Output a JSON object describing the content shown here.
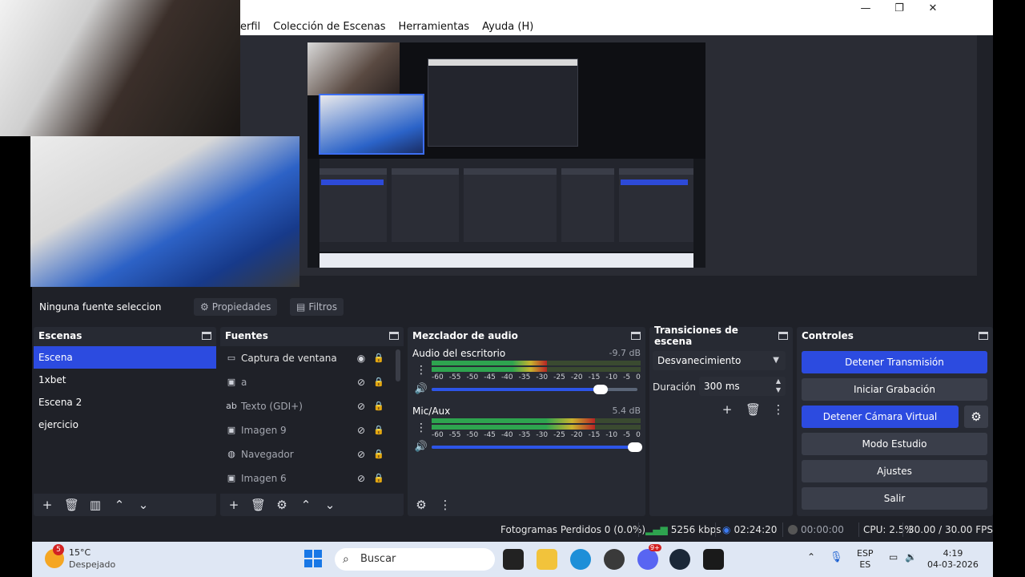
{
  "window": {
    "controls": [
      "—",
      "❐",
      "✕"
    ]
  },
  "menu": {
    "items": [
      "erfil",
      "Colección de Escenas",
      "Herramientas",
      "Ayuda (H)"
    ]
  },
  "source_bar": {
    "no_source": "Ninguna fuente seleccionad",
    "properties": "Propiedades",
    "filters": "Filtros"
  },
  "scenes": {
    "title": "Escenas",
    "items": [
      "Escena",
      "1xbet",
      "Escena 2",
      "ejercicio"
    ],
    "active_index": 0
  },
  "sources": {
    "title": "Fuentes",
    "items": [
      {
        "name": "Captura de ventana",
        "icon": "window-icon",
        "visible": true
      },
      {
        "name": "a",
        "icon": "image-icon",
        "visible": false
      },
      {
        "name": "Texto (GDI+)",
        "icon": "text-icon",
        "visible": false
      },
      {
        "name": "Imagen 9",
        "icon": "image-icon",
        "visible": false
      },
      {
        "name": "Navegador",
        "icon": "browser-icon",
        "visible": false
      },
      {
        "name": "Imagen 6",
        "icon": "image-icon",
        "visible": false
      }
    ]
  },
  "mixer": {
    "title": "Mezclador de audio",
    "channels": [
      {
        "name": "Audio del escritorio",
        "db": "-9.7 dB",
        "level": 0.55,
        "volume": 0.82
      },
      {
        "name": "Mic/Aux",
        "db": "5.4 dB",
        "level": 0.78,
        "volume": 0.99
      }
    ],
    "ticks": [
      "-60",
      "-55",
      "-50",
      "-45",
      "-40",
      "-35",
      "-30",
      "-25",
      "-20",
      "-15",
      "-10",
      "-5",
      "0"
    ]
  },
  "transitions": {
    "title": "Transiciones de escena",
    "selected": "Desvanecimiento",
    "duration_label": "Duración",
    "duration_value": "300 ms"
  },
  "controls": {
    "title": "Controles",
    "buttons": [
      {
        "label": "Detener Transmisión",
        "primary": true
      },
      {
        "label": "Iniciar Grabación",
        "primary": false
      },
      {
        "label": "Detener Cámara Virtual",
        "primary": true
      },
      {
        "label": "Modo Estudio",
        "primary": false
      },
      {
        "label": "Ajustes",
        "primary": false
      },
      {
        "label": "Salir",
        "primary": false
      }
    ]
  },
  "status": {
    "dropped": "Fotogramas Perdidos 0 (0.0%)",
    "bitrate": "5256 kbps",
    "live_time": "02:24:20",
    "rec_time": "00:00:00",
    "cpu": "CPU: 2.5%",
    "fps": "30.00 / 30.00 FPS"
  },
  "taskbar": {
    "weather_badge": "5",
    "temp": "15°C",
    "condition": "Despejado",
    "search_placeholder": "Buscar",
    "lang_top": "ESP",
    "lang_bottom": "ES",
    "time": "4:19",
    "date": "04-03-2026",
    "discord_badge": "9+"
  },
  "colors": {
    "accent": "#2c4be0",
    "panel": "#272a33",
    "meter_green": "#2ea44f",
    "meter_yellow": "#c8b22e",
    "meter_red": "#b72424"
  }
}
